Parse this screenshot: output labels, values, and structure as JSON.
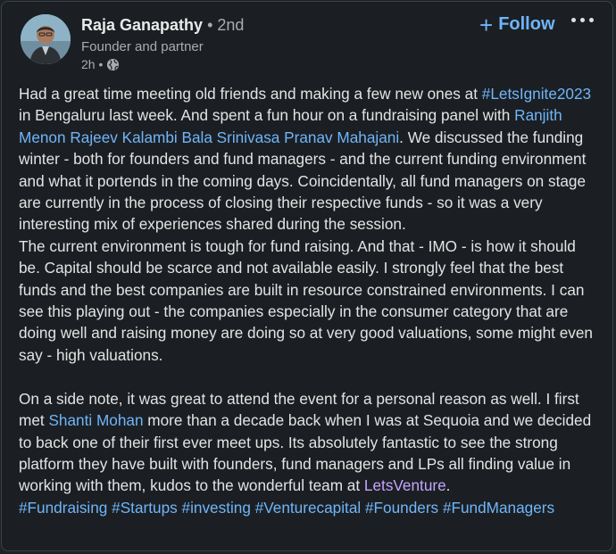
{
  "author": {
    "name": "Raja Ganapathy",
    "degree": "• 2nd",
    "headline": "Founder and partner",
    "time": "2h •",
    "visibility_icon": "globe-icon"
  },
  "actions": {
    "follow_icon": "+",
    "follow_label": "Follow",
    "more_icon": "more-horizontal-icon"
  },
  "colors": {
    "background": "#1b1f23",
    "link": "#70b5f9",
    "company_mention": "#c4a6ff",
    "text": "#e3e3e3",
    "secondary_text": "#a9acaf"
  },
  "post": {
    "p1": {
      "t1": "Had a great time meeting old friends and making a few new ones at ",
      "hashtag_event": "#LetsIgnite2023",
      "t2": " in Bengaluru last week. And spent a fun hour on a fundraising panel with ",
      "mention_1": "Ranjith Menon",
      "mention_2": "Rajeev Kalambi",
      "mention_3": "Bala Srinivasa",
      "mention_4": "Pranav Mahajani",
      "t3": ". We discussed the funding winter - both for founders and fund managers - and the current funding environment and what it portends in the coming days. Coincidentally, all fund managers on stage are currently in the process of closing their respective funds - so it was a very interesting mix of experiences shared during the session."
    },
    "p2": "The current environment is tough for fund raising. And that - IMO - is how it should be. Capital should be scarce and not available easily. I strongly feel that the best funds and the best companies are built in resource constrained environments. I can see this playing out - the companies especially in the consumer category that are doing well and raising money are doing so at very good valuations, some might even say - high valuations.",
    "p3": {
      "t1": "On a side note, it was great to attend the event for a personal reason as well. I first met ",
      "mention_5": "Shanti Mohan",
      "t2": " more than a decade back when I was at Sequoia and we decided to back one of their first ever meet ups. Its absolutely fantastic to see the strong platform they have built with founders, fund managers and LPs all finding value in working with them, kudos to the wonderful team at ",
      "company": "LetsVenture",
      "t3": "."
    },
    "hashtags": [
      "#Fundraising",
      "#Startups",
      "#investing",
      "#Venturecapital",
      "#Founders",
      "#FundManagers"
    ]
  }
}
